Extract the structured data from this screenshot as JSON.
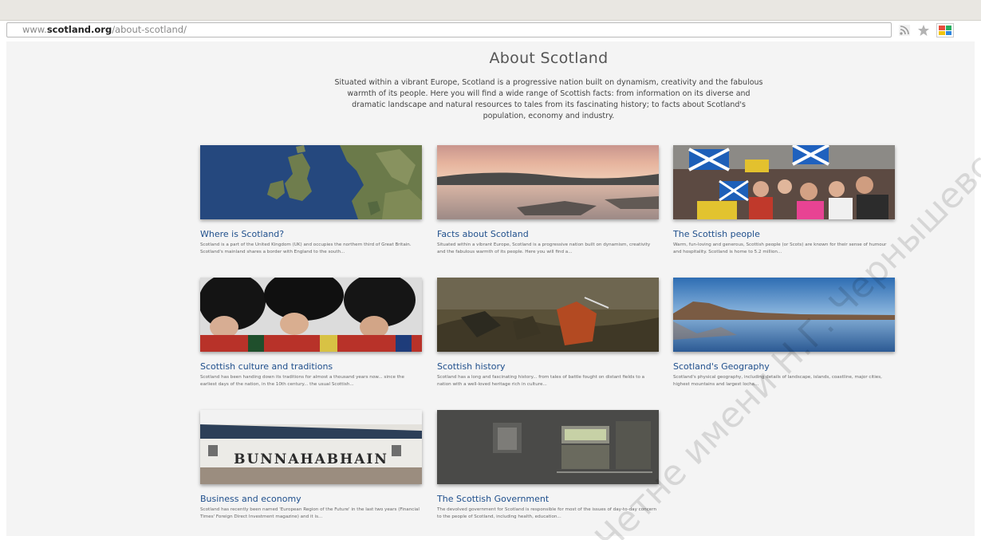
{
  "browser": {
    "url_domain_prefix": "www.",
    "url_domain": "scotland.org",
    "url_path": "/about-scotland/"
  },
  "page": {
    "title": "About Scotland",
    "intro": "Situated within a vibrant Europe, Scotland is a progressive nation built on dynamism, creativity and the fabulous warmth of its people. Here you will find a wide range of Scottish facts: from information on its diverse and dramatic landscape and natural resources to tales from its fascinating history; to facts about Scotland's population, economy and industry."
  },
  "cards": [
    {
      "title": "Where is Scotland?",
      "desc": "Scotland is a part of the United Kingdom (UK) and occupies the northern third of Great Britain. Scotland's mainland shares a border with England to the south..."
    },
    {
      "title": "Facts about Scotland",
      "desc": "Situated within a vibrant Europe, Scotland is a progressive nation built on dynamism, creativity and the fabulous warmth of its people. Here you will find a..."
    },
    {
      "title": "The Scottish people",
      "desc": "Warm, fun-loving and generous, Scottish people (or Scots) are known for their sense of humour and hospitality. Scotland is home to 5.2 million..."
    },
    {
      "title": "Scottish culture and traditions",
      "desc": "Scotland has been handing down its traditions for almost a thousand years now... since the earliest days of the nation, in the 10th century... the usual Scottish..."
    },
    {
      "title": "Scottish history",
      "desc": "Scotland has a long and fascinating history... from tales of battle fought on distant fields to a nation with a well-loved heritage rich in culture..."
    },
    {
      "title": "Scotland's Geography",
      "desc": "Scotland's physical geography, including details of landscape, islands, coastline, major cities, highest mountains and largest lochs..."
    },
    {
      "title": "Business and economy",
      "desc": "Scotland has recently been named 'European Region of the Future' in the last two years (Financial Times' Foreign Direct Investment magazine) and it is..."
    },
    {
      "title": "The Scottish Government",
      "desc": "The devolved government for Scotland is responsible for most of the issues of day-to-day concern to the people of Scotland, including health, education..."
    }
  ],
  "image_labels": {
    "distillery_sign": "BUNNAHABHAIN"
  },
  "watermark": "Четне имени Н.Г. Чернышевского"
}
